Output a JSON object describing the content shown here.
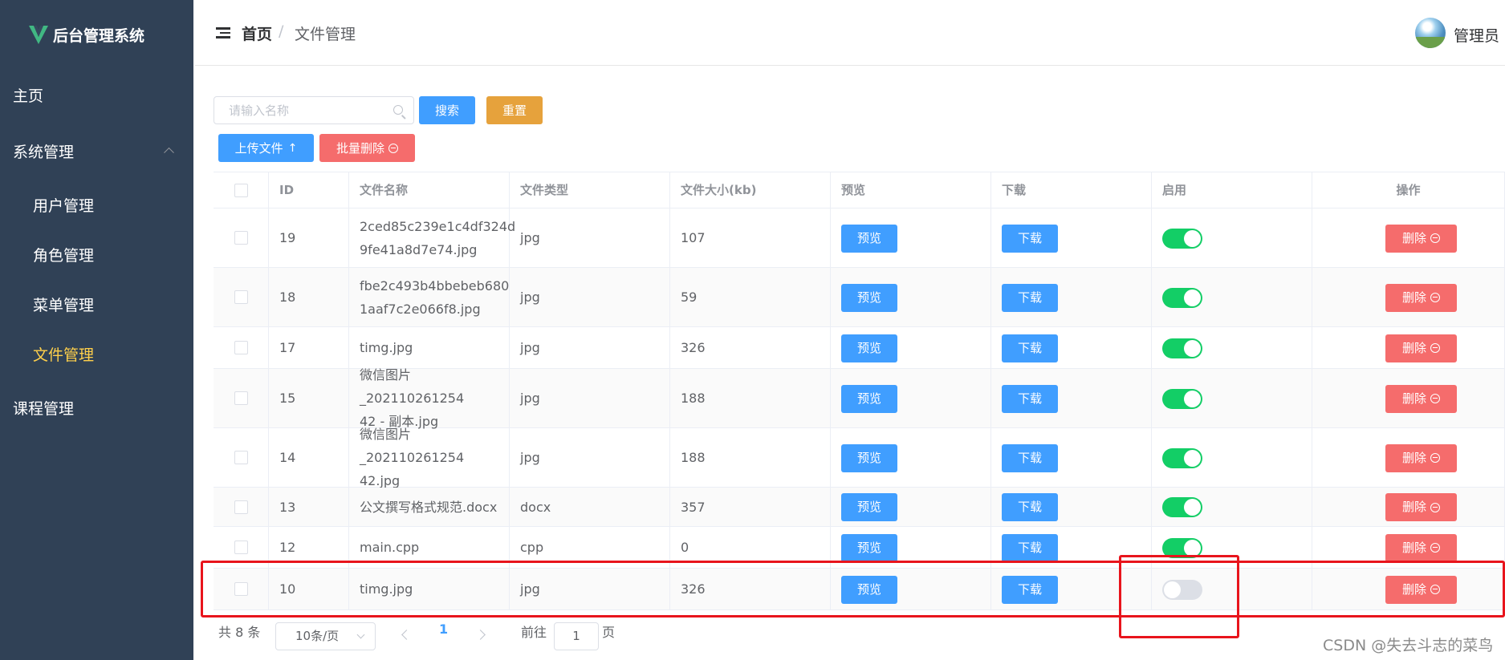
{
  "sidebar": {
    "title": "后台管理系统",
    "items": [
      {
        "label": "主页"
      },
      {
        "label": "系统管理"
      },
      {
        "label": "用户管理"
      },
      {
        "label": "角色管理"
      },
      {
        "label": "菜单管理"
      },
      {
        "label": "文件管理"
      },
      {
        "label": "课程管理"
      }
    ]
  },
  "header": {
    "breadcrumb_home": "首页",
    "breadcrumb_sep": "/",
    "breadcrumb_current": "文件管理",
    "user_name": "管理员"
  },
  "toolbar": {
    "search_placeholder": "请输入名称",
    "search_label": "搜索",
    "reset_label": "重置",
    "upload_label": "上传文件",
    "batch_delete_label": "批量删除"
  },
  "table": {
    "columns": [
      "ID",
      "文件名称",
      "文件类型",
      "文件大小(kb)",
      "预览",
      "下载",
      "启用",
      "操作"
    ],
    "rows": [
      {
        "id": "19",
        "name_line1": "2ced85c239e1c4df324d",
        "name_line2": "9fe41a8d7e74.jpg",
        "type": "jpg",
        "size": "107",
        "enabled": true
      },
      {
        "id": "18",
        "name_line1": "fbe2c493b4bbebeb680",
        "name_line2": "1aaf7c2e066f8.jpg",
        "type": "jpg",
        "size": "59",
        "enabled": true
      },
      {
        "id": "17",
        "name_line1": "timg.jpg",
        "name_line2": "",
        "type": "jpg",
        "size": "326",
        "enabled": true
      },
      {
        "id": "15",
        "name_line1": "微信图片_202110261254",
        "name_line2": "42 - 副本.jpg",
        "type": "jpg",
        "size": "188",
        "enabled": true
      },
      {
        "id": "14",
        "name_line1": "微信图片_202110261254",
        "name_line2": "42.jpg",
        "type": "jpg",
        "size": "188",
        "enabled": true
      },
      {
        "id": "13",
        "name_line1": "公文撰写格式规范.docx",
        "name_line2": "",
        "type": "docx",
        "size": "357",
        "enabled": true
      },
      {
        "id": "12",
        "name_line1": "main.cpp",
        "name_line2": "",
        "type": "cpp",
        "size": "0",
        "enabled": true
      },
      {
        "id": "10",
        "name_line1": "timg.jpg",
        "name_line2": "",
        "type": "jpg",
        "size": "326",
        "enabled": false
      }
    ],
    "preview_label": "预览",
    "download_label": "下载",
    "delete_label": "删除"
  },
  "pagination": {
    "total": "共 8 条",
    "page_size": "10条/页",
    "current_page": "1",
    "goto_prefix": "前往",
    "goto_value": "1",
    "goto_suffix": "页"
  },
  "watermark": "CSDN @失去斗志的菜鸟",
  "colors": {
    "sidebar_bg": "#304156",
    "active_menu": "#ffd04b",
    "primary": "#409eff",
    "warning": "#e6a23c",
    "danger": "#f56c6c",
    "switch_on": "#13ce66",
    "annotation": "#e8141c"
  }
}
